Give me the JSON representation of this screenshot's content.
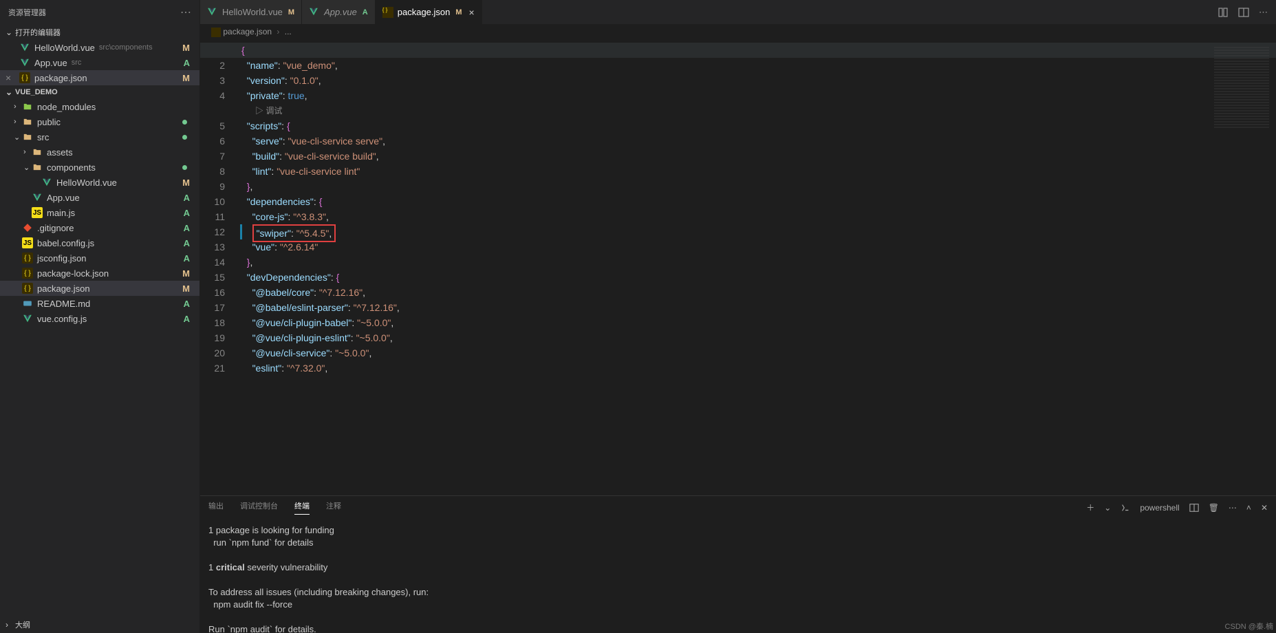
{
  "sidebar": {
    "title": "资源管理器",
    "open_editors_label": "打开的编辑器",
    "outline_label": "大纲",
    "project": "VUE_DEMO",
    "editors": [
      {
        "name": "HelloWorld.vue",
        "path": "src\\components",
        "icon": "vue",
        "badge": "M"
      },
      {
        "name": "App.vue",
        "path": "src",
        "icon": "vue",
        "badge": "A"
      },
      {
        "name": "package.json",
        "path": "",
        "icon": "json",
        "badge": "M",
        "active": true
      }
    ],
    "tree": [
      {
        "name": "node_modules",
        "icon": "node",
        "depth": 1,
        "chev": "›"
      },
      {
        "name": "public",
        "icon": "folder",
        "depth": 1,
        "chev": "›",
        "dot": true
      },
      {
        "name": "src",
        "icon": "folder",
        "depth": 1,
        "chev": "⌄",
        "dot": true
      },
      {
        "name": "assets",
        "icon": "folder",
        "depth": 2,
        "chev": "›"
      },
      {
        "name": "components",
        "icon": "folder",
        "depth": 2,
        "chev": "⌄",
        "dot": true
      },
      {
        "name": "HelloWorld.vue",
        "icon": "vue",
        "depth": 3,
        "badge": "M"
      },
      {
        "name": "App.vue",
        "icon": "vue",
        "depth": 2,
        "badge": "A"
      },
      {
        "name": "main.js",
        "icon": "js",
        "depth": 2,
        "badge": "A"
      },
      {
        "name": ".gitignore",
        "icon": "git",
        "depth": 1,
        "badge": "A"
      },
      {
        "name": "babel.config.js",
        "icon": "js",
        "depth": 1,
        "badge": "A"
      },
      {
        "name": "jsconfig.json",
        "icon": "json",
        "depth": 1,
        "badge": "A"
      },
      {
        "name": "package-lock.json",
        "icon": "json",
        "depth": 1,
        "badge": "M"
      },
      {
        "name": "package.json",
        "icon": "json",
        "depth": 1,
        "badge": "M",
        "active": true
      },
      {
        "name": "README.md",
        "icon": "md",
        "depth": 1,
        "badge": "A"
      },
      {
        "name": "vue.config.js",
        "icon": "vue",
        "depth": 1,
        "badge": "A"
      }
    ]
  },
  "tabs": [
    {
      "name": "HelloWorld.vue",
      "icon": "vue",
      "badge": "M"
    },
    {
      "name": "App.vue",
      "icon": "vue",
      "badge": "A",
      "italic": true
    },
    {
      "name": "package.json",
      "icon": "json",
      "badge": "M",
      "active": true,
      "closable": true
    }
  ],
  "breadcrumb": {
    "file": "package.json",
    "sep": "›",
    "rest": "..."
  },
  "debug_label": "▷ 调试",
  "code": {
    "lines": [
      {
        "n": 1,
        "seg": [
          {
            "t": "{",
            "c": "brace"
          }
        ],
        "cur": true
      },
      {
        "n": 2,
        "seg": [
          {
            "t": "  "
          },
          {
            "t": "\"name\"",
            "c": "key"
          },
          {
            "t": ": "
          },
          {
            "t": "\"vue_demo\"",
            "c": "str"
          },
          {
            "t": ","
          }
        ]
      },
      {
        "n": 3,
        "seg": [
          {
            "t": "  "
          },
          {
            "t": "\"version\"",
            "c": "key"
          },
          {
            "t": ": "
          },
          {
            "t": "\"0.1.0\"",
            "c": "str"
          },
          {
            "t": ","
          }
        ]
      },
      {
        "n": 4,
        "seg": [
          {
            "t": "  "
          },
          {
            "t": "\"private\"",
            "c": "key"
          },
          {
            "t": ": "
          },
          {
            "t": "true",
            "c": "bool"
          },
          {
            "t": ","
          }
        ]
      },
      {
        "n": 0,
        "debug": true
      },
      {
        "n": 5,
        "seg": [
          {
            "t": "  "
          },
          {
            "t": "\"scripts\"",
            "c": "key"
          },
          {
            "t": ": "
          },
          {
            "t": "{",
            "c": "brace"
          }
        ]
      },
      {
        "n": 6,
        "seg": [
          {
            "t": "    "
          },
          {
            "t": "\"serve\"",
            "c": "key"
          },
          {
            "t": ": "
          },
          {
            "t": "\"vue-cli-service serve\"",
            "c": "str"
          },
          {
            "t": ","
          }
        ]
      },
      {
        "n": 7,
        "seg": [
          {
            "t": "    "
          },
          {
            "t": "\"build\"",
            "c": "key"
          },
          {
            "t": ": "
          },
          {
            "t": "\"vue-cli-service build\"",
            "c": "str"
          },
          {
            "t": ","
          }
        ]
      },
      {
        "n": 8,
        "seg": [
          {
            "t": "    "
          },
          {
            "t": "\"lint\"",
            "c": "key"
          },
          {
            "t": ": "
          },
          {
            "t": "\"vue-cli-service lint\"",
            "c": "str"
          }
        ]
      },
      {
        "n": 9,
        "seg": [
          {
            "t": "  "
          },
          {
            "t": "}",
            "c": "brace"
          },
          {
            "t": ","
          }
        ]
      },
      {
        "n": 10,
        "seg": [
          {
            "t": "  "
          },
          {
            "t": "\"dependencies\"",
            "c": "key"
          },
          {
            "t": ": "
          },
          {
            "t": "{",
            "c": "brace"
          }
        ]
      },
      {
        "n": 11,
        "seg": [
          {
            "t": "    "
          },
          {
            "t": "\"core-js\"",
            "c": "key"
          },
          {
            "t": ": "
          },
          {
            "t": "\"^3.8.3\"",
            "c": "str"
          },
          {
            "t": ","
          }
        ]
      },
      {
        "n": 12,
        "seg": [
          {
            "t": "    "
          },
          {
            "t": "\"swiper\"",
            "c": "key",
            "hl": true
          },
          {
            "t": ": ",
            "hl": true
          },
          {
            "t": "\"^5.4.5\"",
            "c": "str",
            "hl": true
          },
          {
            "t": ",",
            "hl": true
          }
        ],
        "mod": true
      },
      {
        "n": 13,
        "seg": [
          {
            "t": "    "
          },
          {
            "t": "\"vue\"",
            "c": "key"
          },
          {
            "t": ": "
          },
          {
            "t": "\"^2.6.14\"",
            "c": "str"
          }
        ]
      },
      {
        "n": 14,
        "seg": [
          {
            "t": "  "
          },
          {
            "t": "}",
            "c": "brace"
          },
          {
            "t": ","
          }
        ]
      },
      {
        "n": 15,
        "seg": [
          {
            "t": "  "
          },
          {
            "t": "\"devDependencies\"",
            "c": "key"
          },
          {
            "t": ": "
          },
          {
            "t": "{",
            "c": "brace"
          }
        ]
      },
      {
        "n": 16,
        "seg": [
          {
            "t": "    "
          },
          {
            "t": "\"@babel/core\"",
            "c": "key"
          },
          {
            "t": ": "
          },
          {
            "t": "\"^7.12.16\"",
            "c": "str"
          },
          {
            "t": ","
          }
        ]
      },
      {
        "n": 17,
        "seg": [
          {
            "t": "    "
          },
          {
            "t": "\"@babel/eslint-parser\"",
            "c": "key"
          },
          {
            "t": ": "
          },
          {
            "t": "\"^7.12.16\"",
            "c": "str"
          },
          {
            "t": ","
          }
        ]
      },
      {
        "n": 18,
        "seg": [
          {
            "t": "    "
          },
          {
            "t": "\"@vue/cli-plugin-babel\"",
            "c": "key"
          },
          {
            "t": ": "
          },
          {
            "t": "\"~5.0.0\"",
            "c": "str"
          },
          {
            "t": ","
          }
        ]
      },
      {
        "n": 19,
        "seg": [
          {
            "t": "    "
          },
          {
            "t": "\"@vue/cli-plugin-eslint\"",
            "c": "key"
          },
          {
            "t": ": "
          },
          {
            "t": "\"~5.0.0\"",
            "c": "str"
          },
          {
            "t": ","
          }
        ]
      },
      {
        "n": 20,
        "seg": [
          {
            "t": "    "
          },
          {
            "t": "\"@vue/cli-service\"",
            "c": "key"
          },
          {
            "t": ": "
          },
          {
            "t": "\"~5.0.0\"",
            "c": "str"
          },
          {
            "t": ","
          }
        ]
      },
      {
        "n": 21,
        "seg": [
          {
            "t": "    "
          },
          {
            "t": "\"eslint\"",
            "c": "key"
          },
          {
            "t": ": "
          },
          {
            "t": "\"^7.32.0\"",
            "c": "str"
          },
          {
            "t": ","
          }
        ]
      }
    ]
  },
  "panel": {
    "tabs": [
      "输出",
      "调试控制台",
      "终端",
      "注释"
    ],
    "active": 2,
    "shell": "powershell",
    "lines": [
      "1 package is looking for funding",
      "  run `npm fund` for details",
      "",
      {
        "pre": "1 ",
        "crit": "critical",
        "post": " severity vulnerability"
      },
      "",
      "To address all issues (including breaking changes), run:",
      "  npm audit fix --force",
      "",
      "Run `npm audit` for details."
    ]
  },
  "watermark": "CSDN @秦.楠"
}
